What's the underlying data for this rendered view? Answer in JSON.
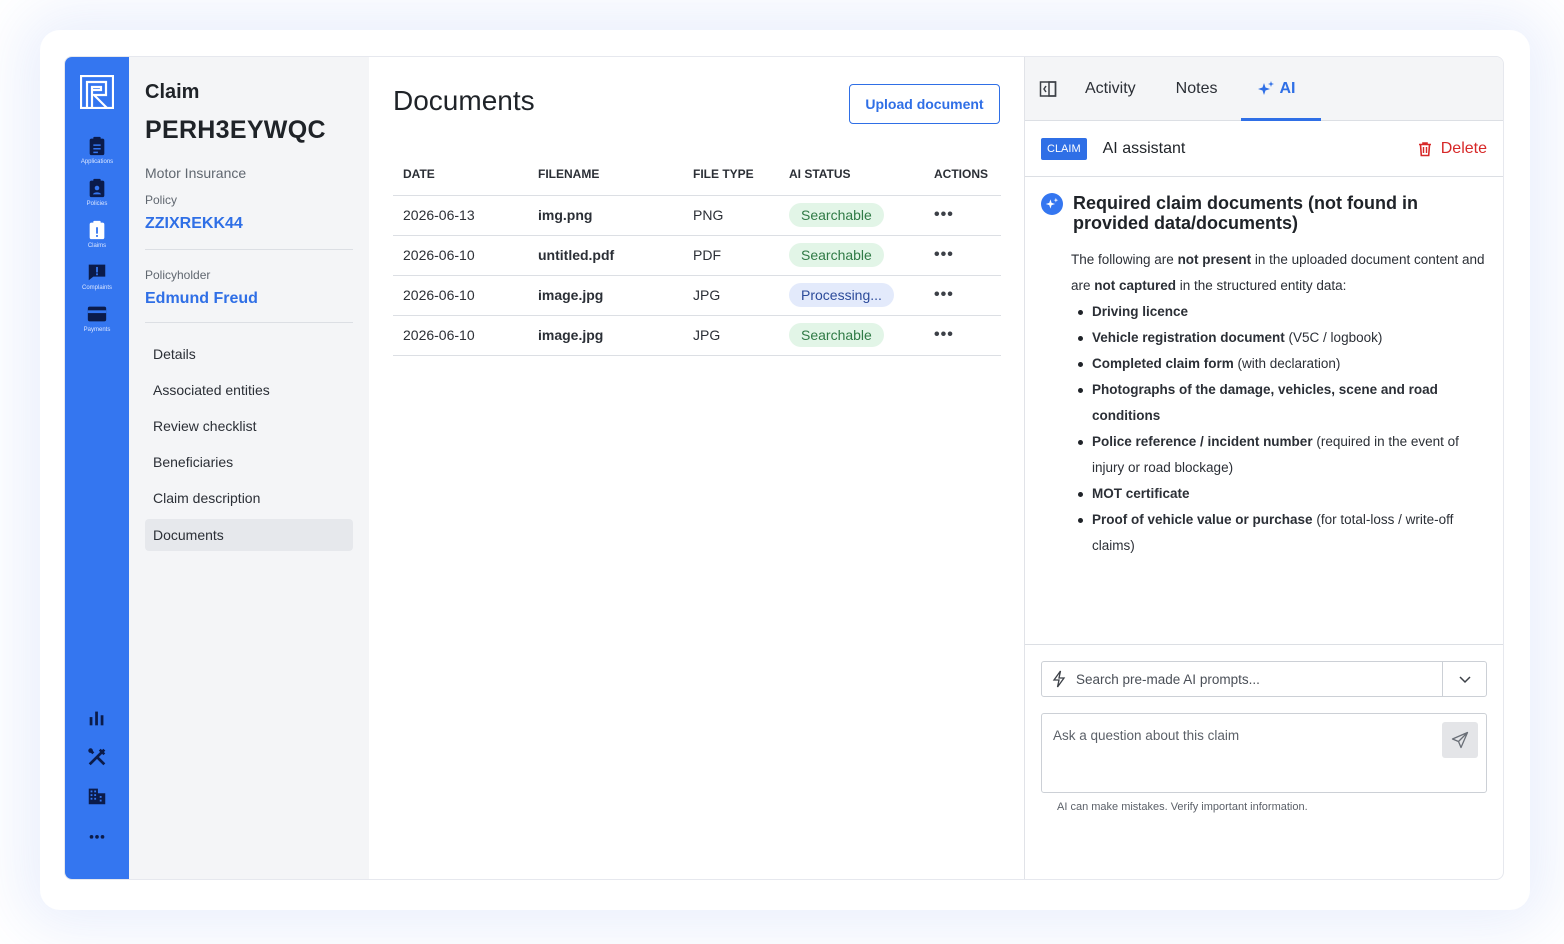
{
  "rail": {
    "items": [
      {
        "label": "Applications",
        "icon": "clipboard-icon"
      },
      {
        "label": "Policies",
        "icon": "badge-icon"
      },
      {
        "label": "Claims",
        "icon": "claim-alert-icon"
      },
      {
        "label": "Complaints",
        "icon": "complaint-icon"
      },
      {
        "label": "Payments",
        "icon": "card-icon"
      }
    ],
    "bottom": [
      "bar-chart-icon",
      "tools-icon",
      "building-icon",
      "more-icon"
    ]
  },
  "claim": {
    "title": "Claim",
    "id": "PERH3EYWQC",
    "product": "Motor Insurance",
    "policy_label": "Policy",
    "policy_value": "ZZIXREKK44",
    "holder_label": "Policyholder",
    "holder_value": "Edmund Freud",
    "nav": [
      "Details",
      "Associated entities",
      "Review checklist",
      "Beneficiaries",
      "Claim description",
      "Documents"
    ],
    "active_nav": "Documents"
  },
  "docs": {
    "title": "Documents",
    "upload_label": "Upload document",
    "columns": [
      "DATE",
      "FILENAME",
      "FILE TYPE",
      "AI STATUS",
      "ACTIONS"
    ],
    "rows": [
      {
        "date": "2026-06-13",
        "filename": "img.png",
        "type": "PNG",
        "status": "Searchable",
        "status_color": "green"
      },
      {
        "date": "2026-06-10",
        "filename": "untitled.pdf",
        "type": "PDF",
        "status": "Searchable",
        "status_color": "green"
      },
      {
        "date": "2026-06-10",
        "filename": "image.jpg",
        "type": "JPG",
        "status": "Processing...",
        "status_color": "blue"
      },
      {
        "date": "2026-06-10",
        "filename": "image.jpg",
        "type": "JPG",
        "status": "Searchable",
        "status_color": "green"
      }
    ],
    "actions_glyph": "•••"
  },
  "ai": {
    "tabs": [
      "Activity",
      "Notes",
      "AI"
    ],
    "active_tab": "AI",
    "badge": "CLAIM",
    "title": "AI assistant",
    "delete_label": "Delete",
    "heading": "Required claim documents (not found in provided data/documents)",
    "intro": {
      "p1": "The following are ",
      "b1": "not present",
      "p2": " in the uploaded document content and are ",
      "b2": "not captured",
      "p3": " in the structured entity data:"
    },
    "items": [
      {
        "bold": "Driving licence",
        "rest": ""
      },
      {
        "bold": "Vehicle registration document",
        "rest": " (V5C / logbook)"
      },
      {
        "bold": "Completed claim form",
        "rest": " (with declaration)"
      },
      {
        "bold": "Photographs of the damage, vehicles, scene and road conditions",
        "rest": ""
      },
      {
        "bold": "Police reference / incident number",
        "rest": " (required in the event of injury or road blockage)"
      },
      {
        "bold": "MOT certificate",
        "rest": ""
      },
      {
        "bold": "Proof of vehicle value or purchase",
        "rest": " (for total-loss / write-off claims)"
      }
    ],
    "prompt_placeholder": "Search pre-made AI prompts...",
    "ask_placeholder": "Ask a question about this claim",
    "disclaimer": "AI can make mistakes. Verify important information.",
    "colors": {
      "accent": "#2f6fe6",
      "rail": "#3476f0",
      "danger": "#d72828"
    }
  }
}
